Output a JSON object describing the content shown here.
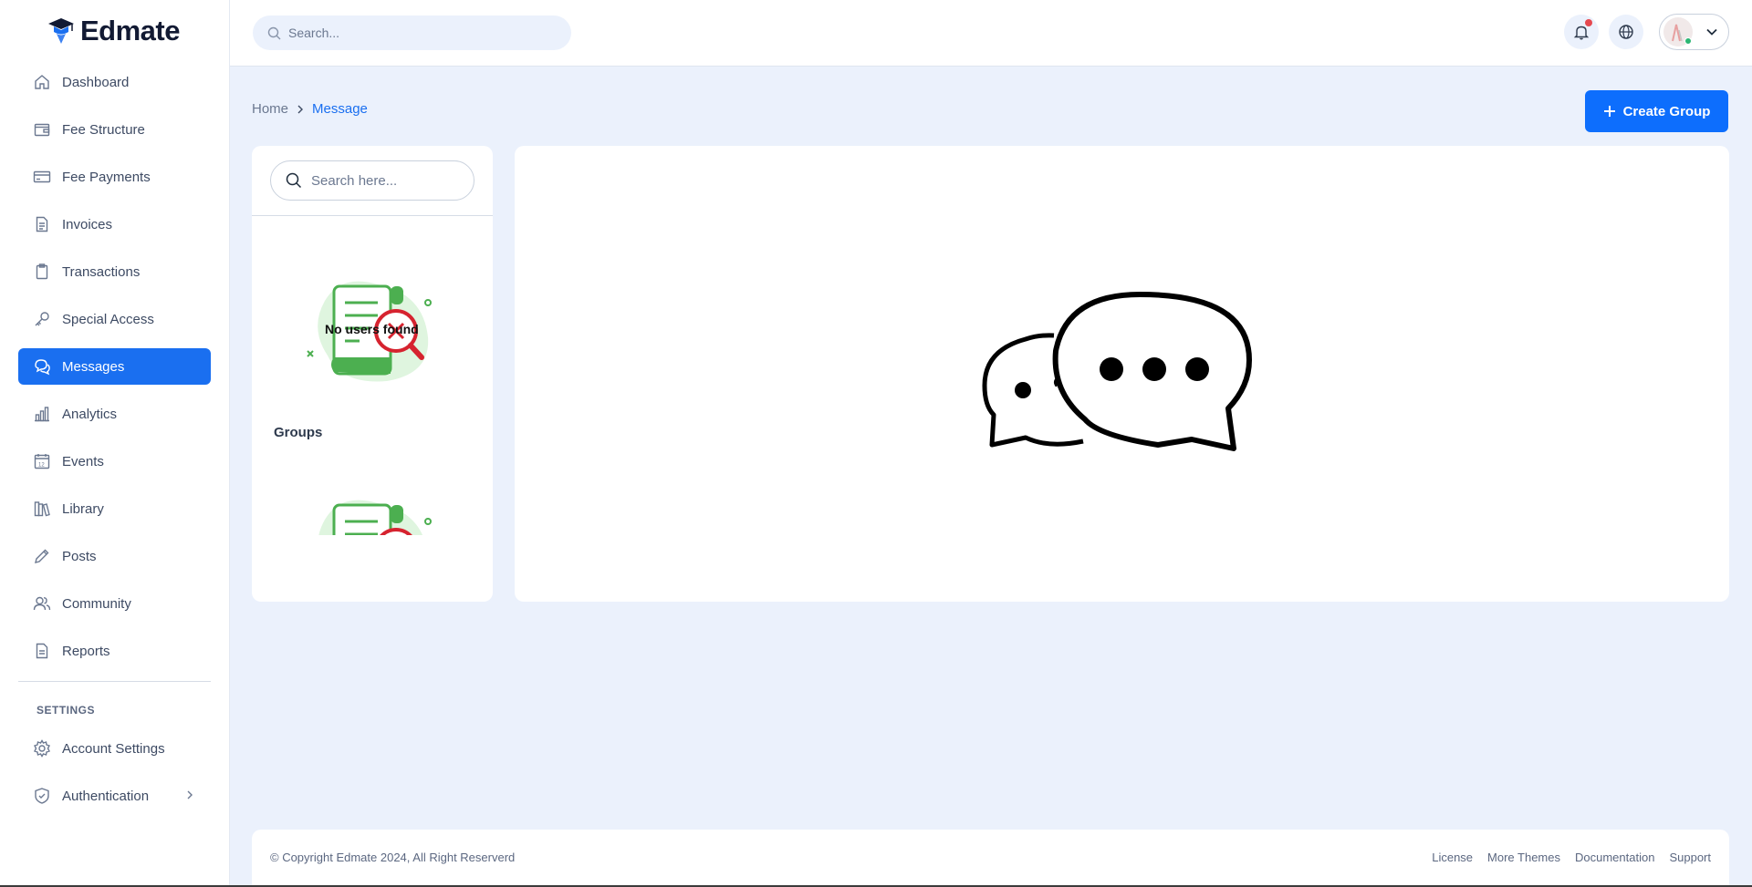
{
  "brand": {
    "name": "Edmate"
  },
  "sidebar": {
    "items": [
      {
        "label": "Dashboard",
        "icon": "home-icon"
      },
      {
        "label": "Fee Structure",
        "icon": "wallet-icon"
      },
      {
        "label": "Fee Payments",
        "icon": "credit-card-icon"
      },
      {
        "label": "Invoices",
        "icon": "document-icon"
      },
      {
        "label": "Transactions",
        "icon": "clipboard-icon"
      },
      {
        "label": "Special Access",
        "icon": "key-icon"
      },
      {
        "label": "Messages",
        "icon": "chat-icon",
        "active": true
      },
      {
        "label": "Analytics",
        "icon": "bar-chart-icon"
      },
      {
        "label": "Events",
        "icon": "calendar-icon"
      },
      {
        "label": "Library",
        "icon": "books-icon"
      },
      {
        "label": "Posts",
        "icon": "pencil-icon"
      },
      {
        "label": "Community",
        "icon": "users-icon"
      },
      {
        "label": "Reports",
        "icon": "report-icon"
      }
    ],
    "settings_heading": "SETTINGS",
    "settings_items": [
      {
        "label": "Account Settings",
        "icon": "gear-icon"
      },
      {
        "label": "Authentication",
        "icon": "shield-icon"
      }
    ]
  },
  "topbar": {
    "search_placeholder": "Search..."
  },
  "breadcrumb": {
    "home": "Home",
    "current": "Message"
  },
  "actions": {
    "create_group": "Create Group"
  },
  "users_panel": {
    "search_placeholder": "Search here...",
    "empty_text": "No users found",
    "groups_heading": "Groups"
  },
  "footer": {
    "copyright": "© Copyright Edmate 2024, All Right Reserverd",
    "links": [
      "License",
      "More Themes",
      "Documentation",
      "Support"
    ]
  },
  "colors": {
    "accent": "#0d6efd",
    "background": "#ebf1fc",
    "illustration_green": "#4caf50",
    "illustration_red": "#d6232f"
  }
}
